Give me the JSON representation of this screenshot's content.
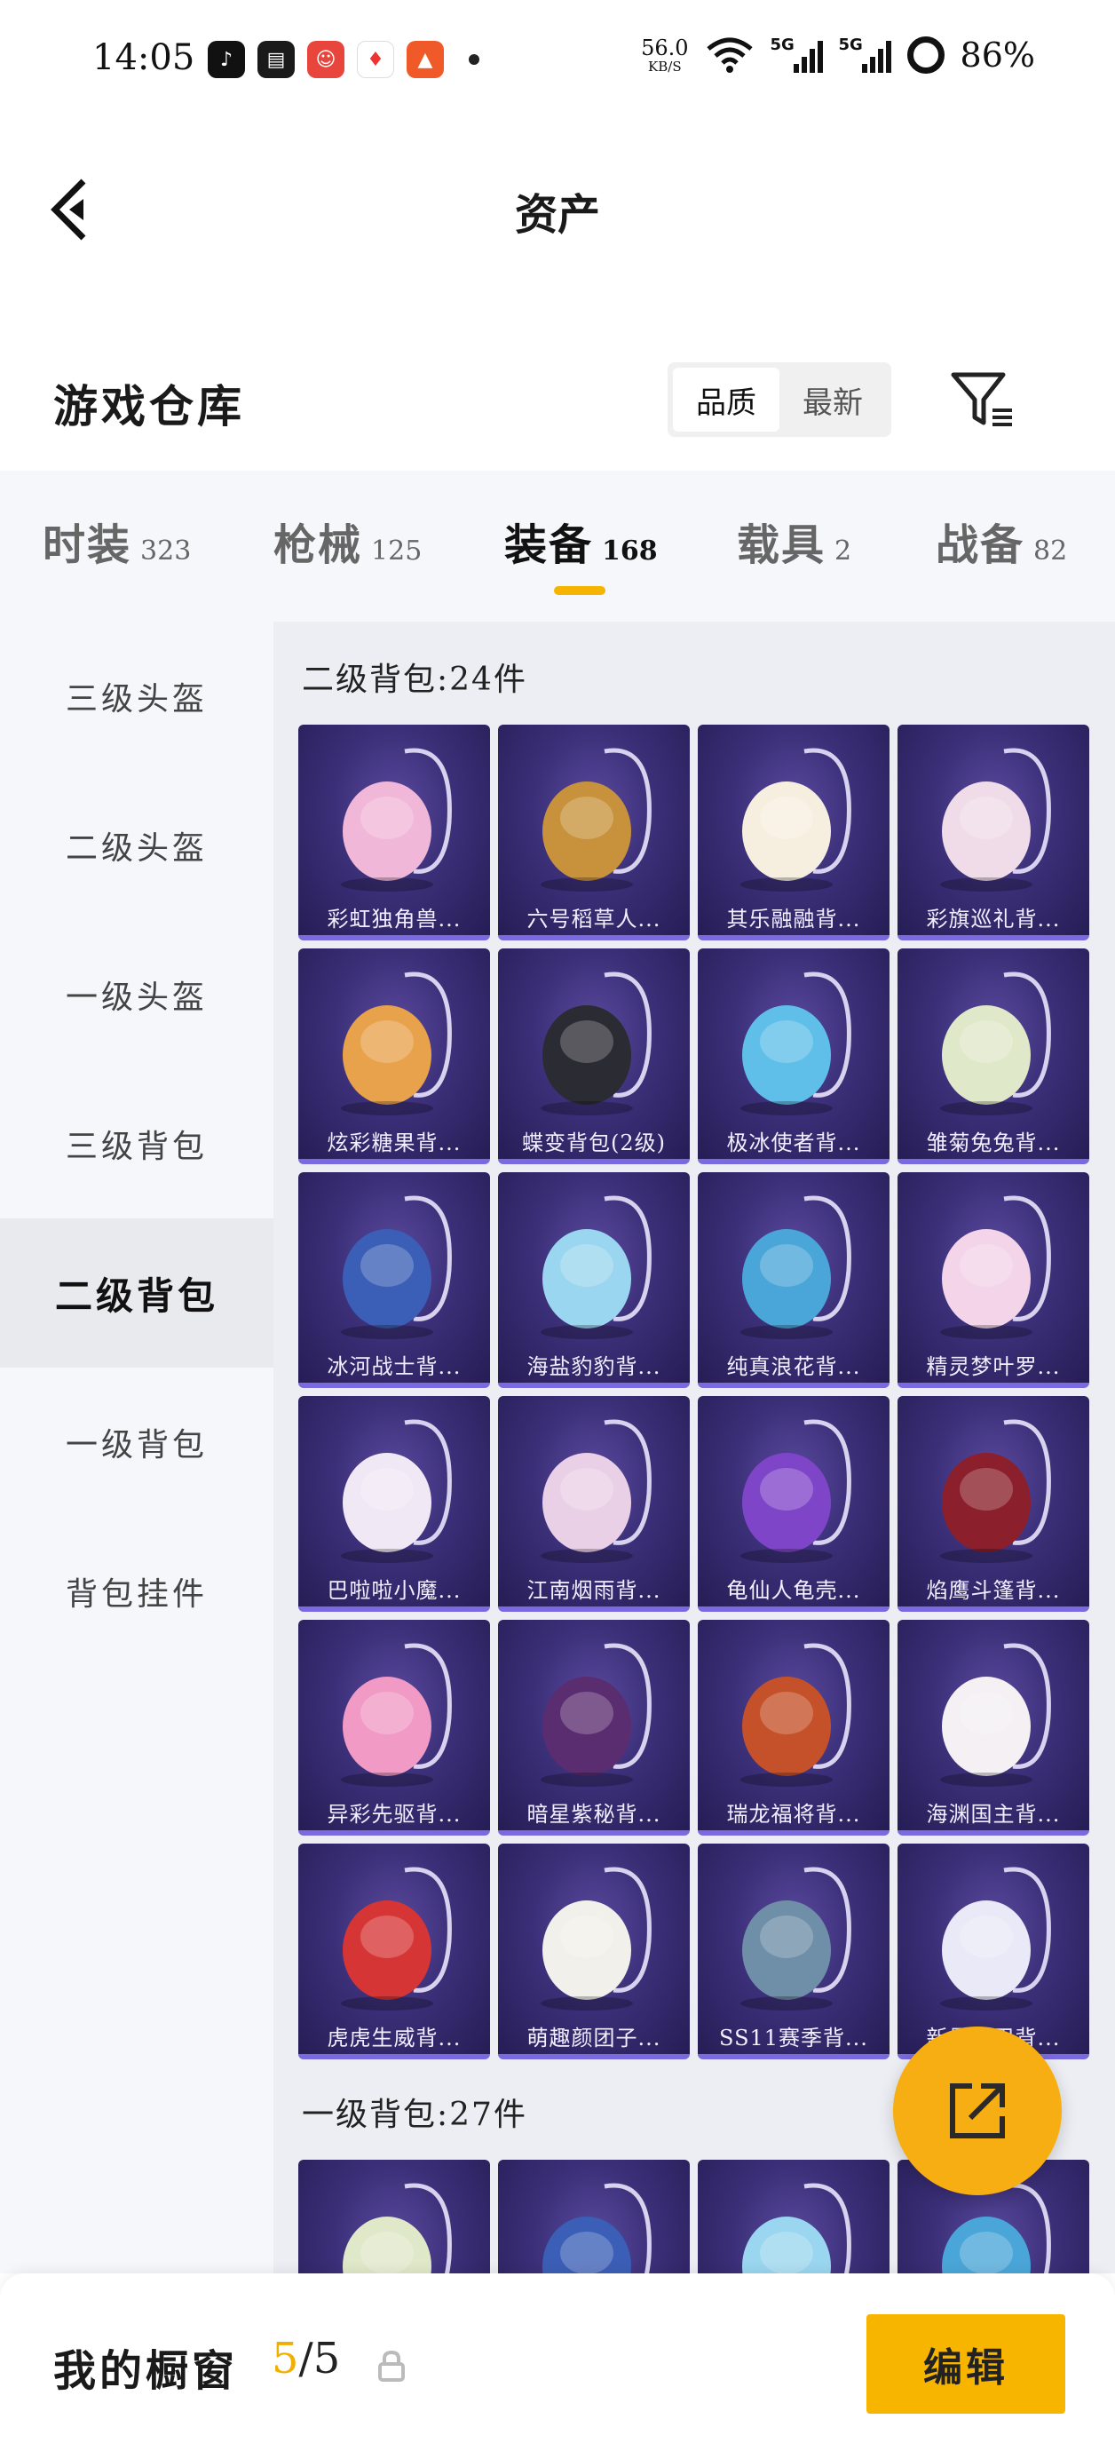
{
  "status_bar": {
    "time": "14:05",
    "net_speed": "56.0",
    "net_unit": "KB/S",
    "sig1": "5G",
    "sig2": "5G",
    "battery": "86%",
    "app_icons": [
      "douyin-icon",
      "xiaohongshu-icon",
      "game-icon",
      "app-icon",
      "cat-icon"
    ]
  },
  "header": {
    "title": "资产"
  },
  "warehouse": {
    "title": "游戏仓库",
    "sort_options": [
      "品质",
      "最新"
    ],
    "active_sort": "品质"
  },
  "tabs": [
    {
      "name": "时装",
      "count": "323"
    },
    {
      "name": "枪械",
      "count": "125"
    },
    {
      "name": "装备",
      "count": "168"
    },
    {
      "name": "载具",
      "count": "2"
    },
    {
      "name": "战备",
      "count": "82"
    }
  ],
  "sidebar": [
    {
      "label": "三级头盔"
    },
    {
      "label": "二级头盔"
    },
    {
      "label": "一级头盔"
    },
    {
      "label": "三级背包"
    },
    {
      "label": "二级背包"
    },
    {
      "label": "一级背包"
    },
    {
      "label": "背包挂件"
    }
  ],
  "sections": [
    {
      "title": "二级背包:24件",
      "items": [
        "彩虹独角兽...",
        "六号稻草人...",
        "其乐融融背...",
        "彩旗巡礼背...",
        "炫彩糖果背...",
        "蝶变背包(2级)",
        "极冰使者背...",
        "雏菊兔兔背...",
        "冰河战士背...",
        "海盐豹豹背...",
        "纯真浪花背...",
        "精灵梦叶罗...",
        "巴啦啦小魔...",
        "江南烟雨背...",
        "龟仙人龟壳...",
        "焰鹰斗篷背...",
        "异彩先驱背...",
        "暗星紫秘背...",
        "瑞龙福将背...",
        "海渊国主背...",
        "虎虎生威背...",
        "萌趣颜团子...",
        "SS11赛季背...",
        "新星战甲背..."
      ]
    },
    {
      "title": "一级背包:27件",
      "items": [
        "",
        "",
        "",
        ""
      ]
    }
  ],
  "bottom": {
    "label": "我的橱窗",
    "current": "5",
    "total": "/5",
    "edit": "编辑"
  },
  "colors": {
    "accent": "#f7b500",
    "card_bg": "#3b2f78",
    "card_border": "#7a6ae0"
  }
}
